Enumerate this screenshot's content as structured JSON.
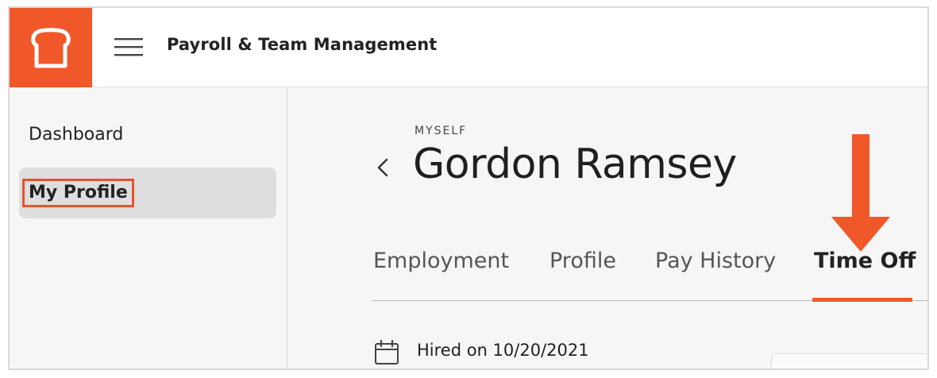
{
  "header": {
    "app_title": "Payroll & Team Management",
    "brand_color": "#f0582a",
    "logo_icon": "toast-bread-icon",
    "menu_icon": "hamburger-menu-icon"
  },
  "sidebar": {
    "items": [
      {
        "label": "Dashboard",
        "active": false
      },
      {
        "label": "My Profile",
        "active": true
      }
    ]
  },
  "main": {
    "eyebrow": "MYSELF",
    "title": "Gordon Ramsey",
    "back_icon": "chevron-left-icon",
    "tabs": [
      {
        "label": "Employment",
        "active": false
      },
      {
        "label": "Profile",
        "active": false
      },
      {
        "label": "Pay History",
        "active": false
      },
      {
        "label": "Time Off",
        "active": true
      }
    ],
    "hired_text": "Hired on 10/20/2021",
    "hired_icon": "calendar-icon",
    "annotation_icon": "down-arrow-icon",
    "accent_color": "#f0582a"
  }
}
